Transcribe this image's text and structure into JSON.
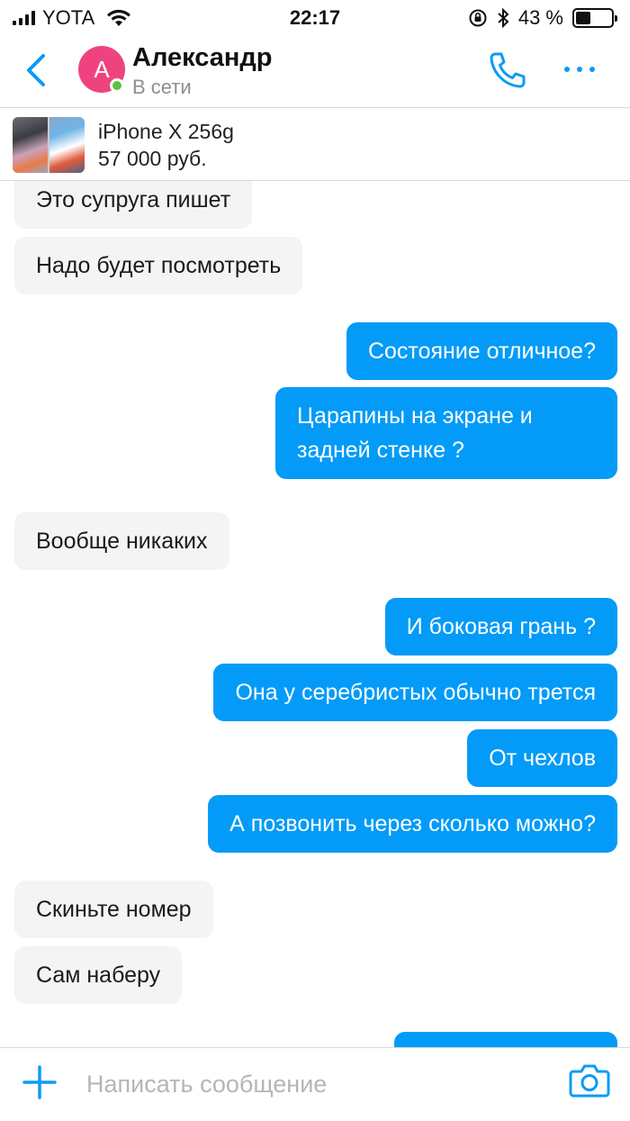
{
  "status_bar": {
    "carrier": "YOTA",
    "time": "22:17",
    "battery": "43 %",
    "battery_level": 0.43
  },
  "header": {
    "avatar_letter": "А",
    "name": "Александр",
    "status": "В сети"
  },
  "listing": {
    "title": "iPhone X 256g",
    "price": "57 000 руб."
  },
  "messages": [
    {
      "side": "in",
      "text": "Это супруга пишет"
    },
    {
      "side": "in",
      "text": "Надо будет посмотреть"
    },
    {
      "side": "out",
      "text": "Состояние отличное?"
    },
    {
      "side": "out",
      "text": "Царапины на экране и задней стенке ?"
    },
    {
      "side": "in",
      "text": "Вообще никаких"
    },
    {
      "side": "out",
      "text": "И боковая грань ?"
    },
    {
      "side": "out",
      "text": "Она у серебристых обычно трется"
    },
    {
      "side": "out",
      "text": "От чехлов"
    },
    {
      "side": "out",
      "text": "А позвонить через сколько можно?"
    },
    {
      "side": "in",
      "text": "Скиньте номер"
    },
    {
      "side": "in",
      "text": "Сам наберу"
    }
  ],
  "composer": {
    "placeholder": "Написать сообщение"
  },
  "colors": {
    "accent": "#039bf7",
    "avatar": "#ef4380",
    "online": "#5ec13c",
    "incoming_bubble": "#f4f4f4"
  }
}
